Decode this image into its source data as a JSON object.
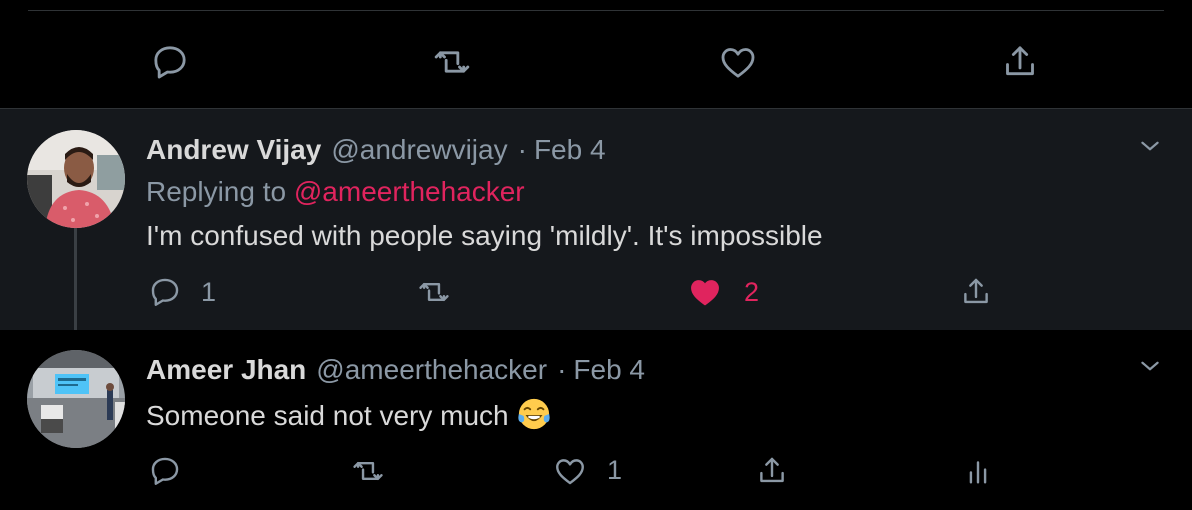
{
  "top_actions": {
    "reply_icon": "reply-icon",
    "retweet_icon": "retweet-icon",
    "like_icon": "heart-icon",
    "share_icon": "share-icon"
  },
  "tweets": [
    {
      "display_name": "Andrew Vijay",
      "handle": "@andrewvijay",
      "separator": "·",
      "date": "Feb 4",
      "replying_prefix": "Replying to",
      "replying_to": "@ameerthehacker",
      "text": "I'm confused with people saying 'mildly'. It's impossible",
      "reply_count": "1",
      "like_count": "2",
      "liked": true
    },
    {
      "display_name": "Ameer Jhan",
      "handle": "@ameerthehacker",
      "separator": "·",
      "date": "Feb 4",
      "text": "Someone said not very much",
      "emoji": "face-with-tears-of-joy",
      "like_count": "1"
    }
  ],
  "colors": {
    "background": "#000000",
    "highlight_background": "#15181c",
    "text_primary": "#d9d9d9",
    "text_secondary": "#8b98a5",
    "accent_pink": "#e0245e",
    "divider": "#2f3336"
  }
}
